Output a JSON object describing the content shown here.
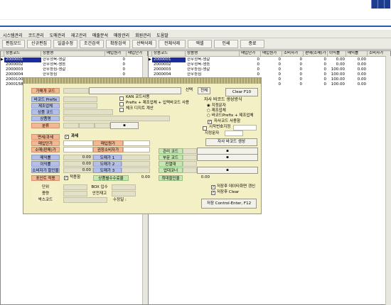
{
  "menu": [
    "시스템관리",
    "코드관리",
    "도매관리",
    "재고관리",
    "매출분석",
    "매장관리",
    "회원관리",
    "도움말"
  ],
  "toolbar": [
    "편집모드",
    "신규편집",
    "일괄수정",
    "조건검색",
    "확장검색",
    "선택삭제",
    "전체삭제",
    "엑셀",
    "인쇄",
    "종료"
  ],
  "left_grid": {
    "headers": [
      "상품코드",
      "상품명",
      "매입원가",
      "매입단가"
    ],
    "rows": [
      [
        "2000001",
        "한우정육-생갈",
        "0",
        ""
      ],
      [
        "2000002",
        "한우정육-생등",
        "0",
        ""
      ],
      [
        "2000003",
        "한우등심-생갈",
        "0",
        ""
      ],
      [
        "2000004",
        "한우등심",
        "0",
        ""
      ],
      [
        "2000100",
        "한우정육-생갈",
        "0",
        ""
      ],
      [
        "2000158",
        "한우정육-생갈",
        "0",
        ""
      ]
    ]
  },
  "right_grid": {
    "headers": [
      "상품코드",
      "상품명",
      "매입단가",
      "매입원가",
      "소비자가",
      "판매(소매)가",
      "이익률",
      "매익률",
      "소비자가"
    ],
    "rows": [
      [
        "2000001",
        "한우정육-생갈",
        "0",
        "0",
        "0",
        "0",
        "0.00",
        "0.00",
        ""
      ],
      [
        "2000002",
        "한우정육-생등",
        "0",
        "0",
        "0",
        "0",
        "0.00",
        "0.00",
        ""
      ],
      [
        "2000003",
        "한우등심-생갈",
        "0",
        "0",
        "0",
        "0",
        "100.00",
        "0.00",
        ""
      ],
      [
        "2000004",
        "한우등심",
        "0",
        "0",
        "0",
        "0",
        "100.00",
        "0.00",
        ""
      ],
      [
        "2000100",
        "한우정육-생갈",
        "0",
        "0",
        "0",
        "0",
        "100.00",
        "0.00",
        ""
      ],
      [
        "2000158",
        "한우정육-생갈",
        "0",
        "0",
        "0",
        "0",
        "100.00",
        "0.00",
        ""
      ]
    ]
  },
  "panel": {
    "code_label": "가매개 코드",
    "prefix_label": "바코드 Prefix",
    "maker_label": "제조업체",
    "pcode_label": "상품 코드",
    "pname_label": "상품명",
    "class_label": "분류",
    "select_btn": "선택",
    "all_btn": "전체",
    "clear_btn": "Clear F10",
    "kan": "KAN 코드사용",
    "prefix_opt": "Prefix + 제조업체 + 입력바코드 사용",
    "check_digit": "체크 디지트 계산",
    "auto_title": "자사 바코드 생성방식",
    "r1": "지정문자",
    "r2": "제조업체",
    "r3": "바코드Prefix + 제조업체",
    "own_use": "자사코드 사용함",
    "start_no": "시작번호지정",
    "designate": "지정문자",
    "gen_btn": "자사 바코드 생성",
    "tax_label": "면세/과세",
    "tax_val": "과세",
    "buy_unit": "매입단가",
    "buy_cost": "매입원가",
    "sale_label": "소매(판매)가",
    "consumer": "권장소비자가",
    "margin": "매익률",
    "margin_v": "0.00",
    "d1": "도매가 1",
    "d2": "도매가 2",
    "d3": "도매가 3",
    "profit": "이익률",
    "profit_v": "0.00",
    "discount": "소비자가 할인율",
    "discount_v": "0.00",
    "point": "포인트 적용",
    "apply": "적용함",
    "stock": "상품별수수료율",
    "stock_v": "0.00",
    "rel": "관리 코드",
    "sub": "부문 코드",
    "shelf": "진열대",
    "buyer": "업대코너",
    "mdisc": "최대할인율",
    "mdisc_v": "0.00",
    "unit": "단위",
    "box": "BOX 입수",
    "qty": "용량",
    "safe": "안전재고",
    "bag": "박스코드",
    "count": "수정일 :",
    "after_save": "저장후 데이타화면 갱신",
    "after_clear": "저장후 Clear",
    "save_btn": "저장 Control-Enter, F12"
  },
  "colors": {
    "title_blue": "#1e3c8e",
    "selected_row": "#1c2c9f",
    "panel_bg": "#f4f0c5"
  }
}
